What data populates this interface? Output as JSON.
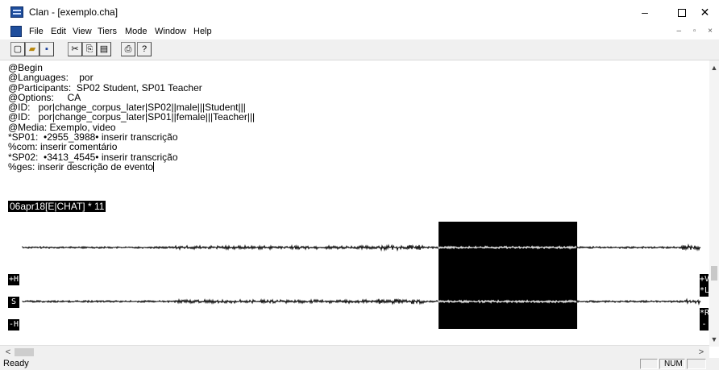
{
  "window": {
    "title": "Clan - [exemplo.cha]",
    "minimize_glyph": "–",
    "close_glyph": "✕"
  },
  "menu": [
    "File",
    "Edit",
    "View",
    "Tiers",
    "Mode",
    "Window",
    "Help"
  ],
  "mdi_controls": "– ▫ ×",
  "toolbar": {
    "new": "▢",
    "open": "▰",
    "save": "▪",
    "cut": "✂",
    "copy": "⎘",
    "paste": "▤",
    "print": "⎙",
    "help": "?"
  },
  "editor": {
    "lines": [
      "@Begin",
      "@Languages:    por",
      "@Participants:  SP02 Student, SP01 Teacher",
      "@Options:     CA",
      "@ID:   por|change_corpus_later|SP02||male|||Student|||",
      "@ID:   por|change_corpus_later|SP01||female|||Teacher|||",
      "@Media: Exemplo, video",
      "*SP01:  •2955_3988• inserir transcrição",
      "%com: inserir comentário",
      "*SP02:  •3413_4545• inserir transcrição",
      "%ges: inserir descrição de evento"
    ],
    "file_label": "06apr18[E|CHAT] * 11"
  },
  "wave": {
    "left_labels": [
      "+H",
      "S",
      "-H"
    ],
    "right_labels": [
      "+V",
      "*L",
      "*R",
      "-V"
    ],
    "selection_start": 0.621,
    "selection_end": 0.821
  },
  "scrollbar": {
    "up": "▲",
    "down": "▼",
    "left": "<",
    "right": ">"
  },
  "status": {
    "text": "Ready",
    "num": "NUM"
  },
  "colors": {
    "waveform": "#000000",
    "selection": "#000000",
    "toolbar_bg": "#f0f0f0"
  }
}
